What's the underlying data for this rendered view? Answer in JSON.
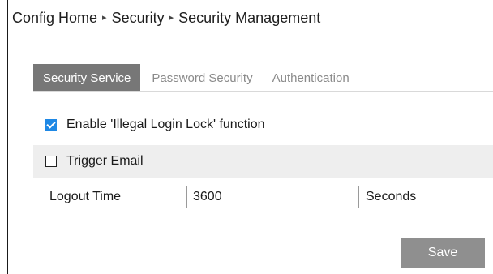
{
  "breadcrumb": {
    "items": [
      "Config Home",
      "Security",
      "Security Management"
    ],
    "separator": "▸"
  },
  "tabs": [
    {
      "label": "Security Service",
      "active": true
    },
    {
      "label": "Password Security",
      "active": false
    },
    {
      "label": "Authentication",
      "active": false
    }
  ],
  "options": {
    "illegal_login_lock": {
      "label": "Enable 'Illegal Login Lock' function",
      "checked": true
    },
    "trigger_email": {
      "label": "Trigger Email",
      "checked": false
    }
  },
  "logout": {
    "label": "Logout Time",
    "value": "3600",
    "unit": "Seconds"
  },
  "actions": {
    "save_label": "Save"
  },
  "colors": {
    "accent": "#1e88e5",
    "tab_active_bg": "#777777",
    "save_bg": "#8f8f8f",
    "row_highlight": "#eeeeee"
  }
}
